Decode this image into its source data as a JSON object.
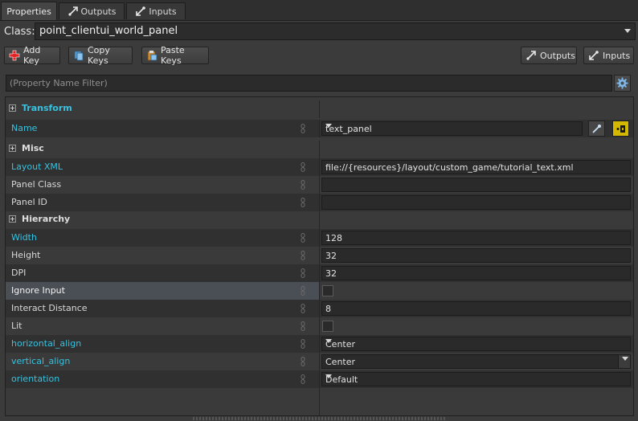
{
  "tabs": [
    {
      "label": "Properties",
      "icon": "none",
      "active": true
    },
    {
      "label": "Outputs",
      "icon": "output-arrow-icon",
      "active": false
    },
    {
      "label": "Inputs",
      "icon": "input-arrow-icon",
      "active": false
    }
  ],
  "class_row": {
    "label": "Class:",
    "value": "point_clientui_world_panel"
  },
  "toolbar": {
    "add_keys": "Add Key",
    "copy_keys": "Copy Keys",
    "paste_keys": "Paste Keys",
    "outputs": "Outputs",
    "inputs": "Inputs"
  },
  "filter": {
    "placeholder": "(Property Name Filter)"
  },
  "categories": {
    "transform": "Transform",
    "misc": "Misc",
    "hierarchy": "Hierarchy"
  },
  "properties": {
    "name": {
      "label": "Name",
      "value": "text_panel"
    },
    "layout_xml": {
      "label": "Layout XML",
      "value": "file://{resources}/layout/custom_game/tutorial_text.xml"
    },
    "panel_class": {
      "label": "Panel Class",
      "value": ""
    },
    "panel_id": {
      "label": "Panel ID",
      "value": ""
    },
    "width": {
      "label": "Width",
      "value": "128"
    },
    "height": {
      "label": "Height",
      "value": "32"
    },
    "dpi": {
      "label": "DPI",
      "value": "32"
    },
    "ignore_input": {
      "label": "Ignore Input",
      "checked": false
    },
    "interact_distance": {
      "label": "Interact Distance",
      "value": "8"
    },
    "lit": {
      "label": "Lit",
      "checked": false
    },
    "horizontal_align": {
      "label": "horizontal_align",
      "value": "Center"
    },
    "vertical_align": {
      "label": "vertical_align",
      "value": "Center"
    },
    "orientation": {
      "label": "orientation",
      "value": "Default"
    }
  },
  "colors": {
    "modified_text": "#36c2e0",
    "background": "#3b3b3b",
    "field_bg": "#2a2a2a"
  }
}
